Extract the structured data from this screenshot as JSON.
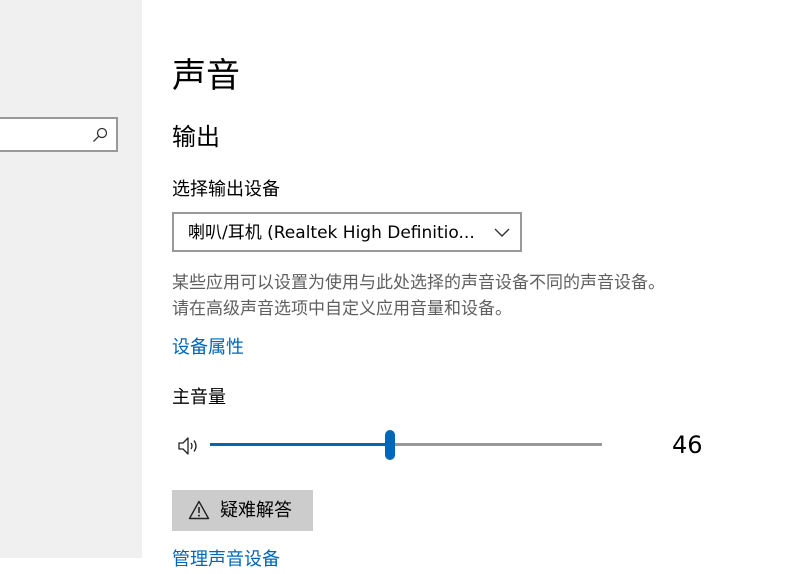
{
  "sidebar": {
    "search": {
      "value": "",
      "placeholder": "",
      "icon": "search-icon"
    }
  },
  "page": {
    "title": "声音",
    "output": {
      "section_title": "输出",
      "device_label": "选择输出设备",
      "device_selected": "喇叭/耳机 (Realtek High Definitio...",
      "description_lines": [
        "某些应用可以设置为使用与此处选择的声音设备不同的声音设备。",
        "请在高级声音选项中自定义应用音量和设备。"
      ],
      "device_properties_link": "设备属性",
      "volume_label": "主音量",
      "volume_value": "46",
      "volume_level": 46,
      "troubleshoot_label": "疑难解答",
      "manage_devices_link": "管理声音设备"
    }
  },
  "colors": {
    "accent": "#0067b8",
    "sidebar_bg": "#f0f0f0",
    "button_bg": "#cccccc",
    "secondary_text": "#5f5f5f"
  }
}
